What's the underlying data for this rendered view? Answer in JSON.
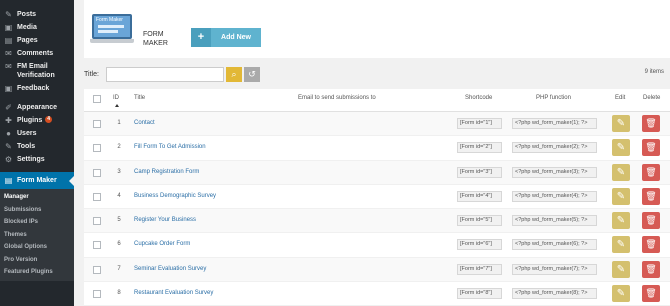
{
  "sidebar": {
    "items": [
      {
        "label": "Posts",
        "icon": "pin-icon"
      },
      {
        "label": "Media",
        "icon": "media-icon"
      },
      {
        "label": "Pages",
        "icon": "page-icon"
      },
      {
        "label": "Comments",
        "icon": "comment-icon"
      },
      {
        "label": "FM Email Verification",
        "icon": "gear-icon"
      },
      {
        "label": "Feedback",
        "icon": "feedback-icon"
      }
    ],
    "items2": [
      {
        "label": "Appearance",
        "icon": "brush-icon"
      },
      {
        "label": "Plugins",
        "icon": "plugin-icon",
        "badge": "4"
      },
      {
        "label": "Users",
        "icon": "user-icon"
      },
      {
        "label": "Tools",
        "icon": "wrench-icon"
      },
      {
        "label": "Settings",
        "icon": "settings-icon"
      }
    ],
    "active": {
      "label": "Form Maker",
      "icon": "form-icon"
    },
    "submenu": [
      "Manager",
      "Submissions",
      "Blocked IPs",
      "Themes",
      "Global Options",
      "Pro Version",
      "Featured Plugins"
    ]
  },
  "header": {
    "logo_text": "Form Maker",
    "title": "FORM MAKER",
    "add_new_label": "Add New"
  },
  "filter": {
    "title_label": "Title:",
    "title_value": "",
    "items_count": "9 items"
  },
  "table": {
    "headers": {
      "id": "ID",
      "title": "Title",
      "email": "Email to send submissions to",
      "shortcode": "Shortcode",
      "php": "PHP function",
      "edit": "Edit",
      "delete": "Delete"
    },
    "rows": [
      {
        "id": "1",
        "title": "Contact",
        "shortcode": "[Form id=\"1\"]",
        "php": "<?php wd_form_maker(1); ?>"
      },
      {
        "id": "2",
        "title": "Fill Form To Get Admission",
        "shortcode": "[Form id=\"2\"]",
        "php": "<?php wd_form_maker(2); ?>"
      },
      {
        "id": "3",
        "title": "Camp Registration Form",
        "shortcode": "[Form id=\"3\"]",
        "php": "<?php wd_form_maker(3); ?>"
      },
      {
        "id": "4",
        "title": "Business Demographic Survey",
        "shortcode": "[Form id=\"4\"]",
        "php": "<?php wd_form_maker(4); ?>"
      },
      {
        "id": "5",
        "title": "Register Your Business",
        "shortcode": "[Form id=\"5\"]",
        "php": "<?php wd_form_maker(5); ?>"
      },
      {
        "id": "6",
        "title": "Cupcake Order Form",
        "shortcode": "[Form id=\"6\"]",
        "php": "<?php wd_form_maker(6); ?>"
      },
      {
        "id": "7",
        "title": "Seminar Evaluation Survey",
        "shortcode": "[Form id=\"7\"]",
        "php": "<?php wd_form_maker(7); ?>"
      },
      {
        "id": "8",
        "title": "Restaurant Evaluation Survey",
        "shortcode": "[Form id=\"8\"]",
        "php": "<?php wd_form_maker(8); ?>"
      }
    ]
  },
  "colors": {
    "sidebar_bg": "#23282d",
    "active_blue": "#0073aa",
    "add_new": "#5fb3cf",
    "edit": "#d4c06e",
    "delete": "#d65a54"
  }
}
